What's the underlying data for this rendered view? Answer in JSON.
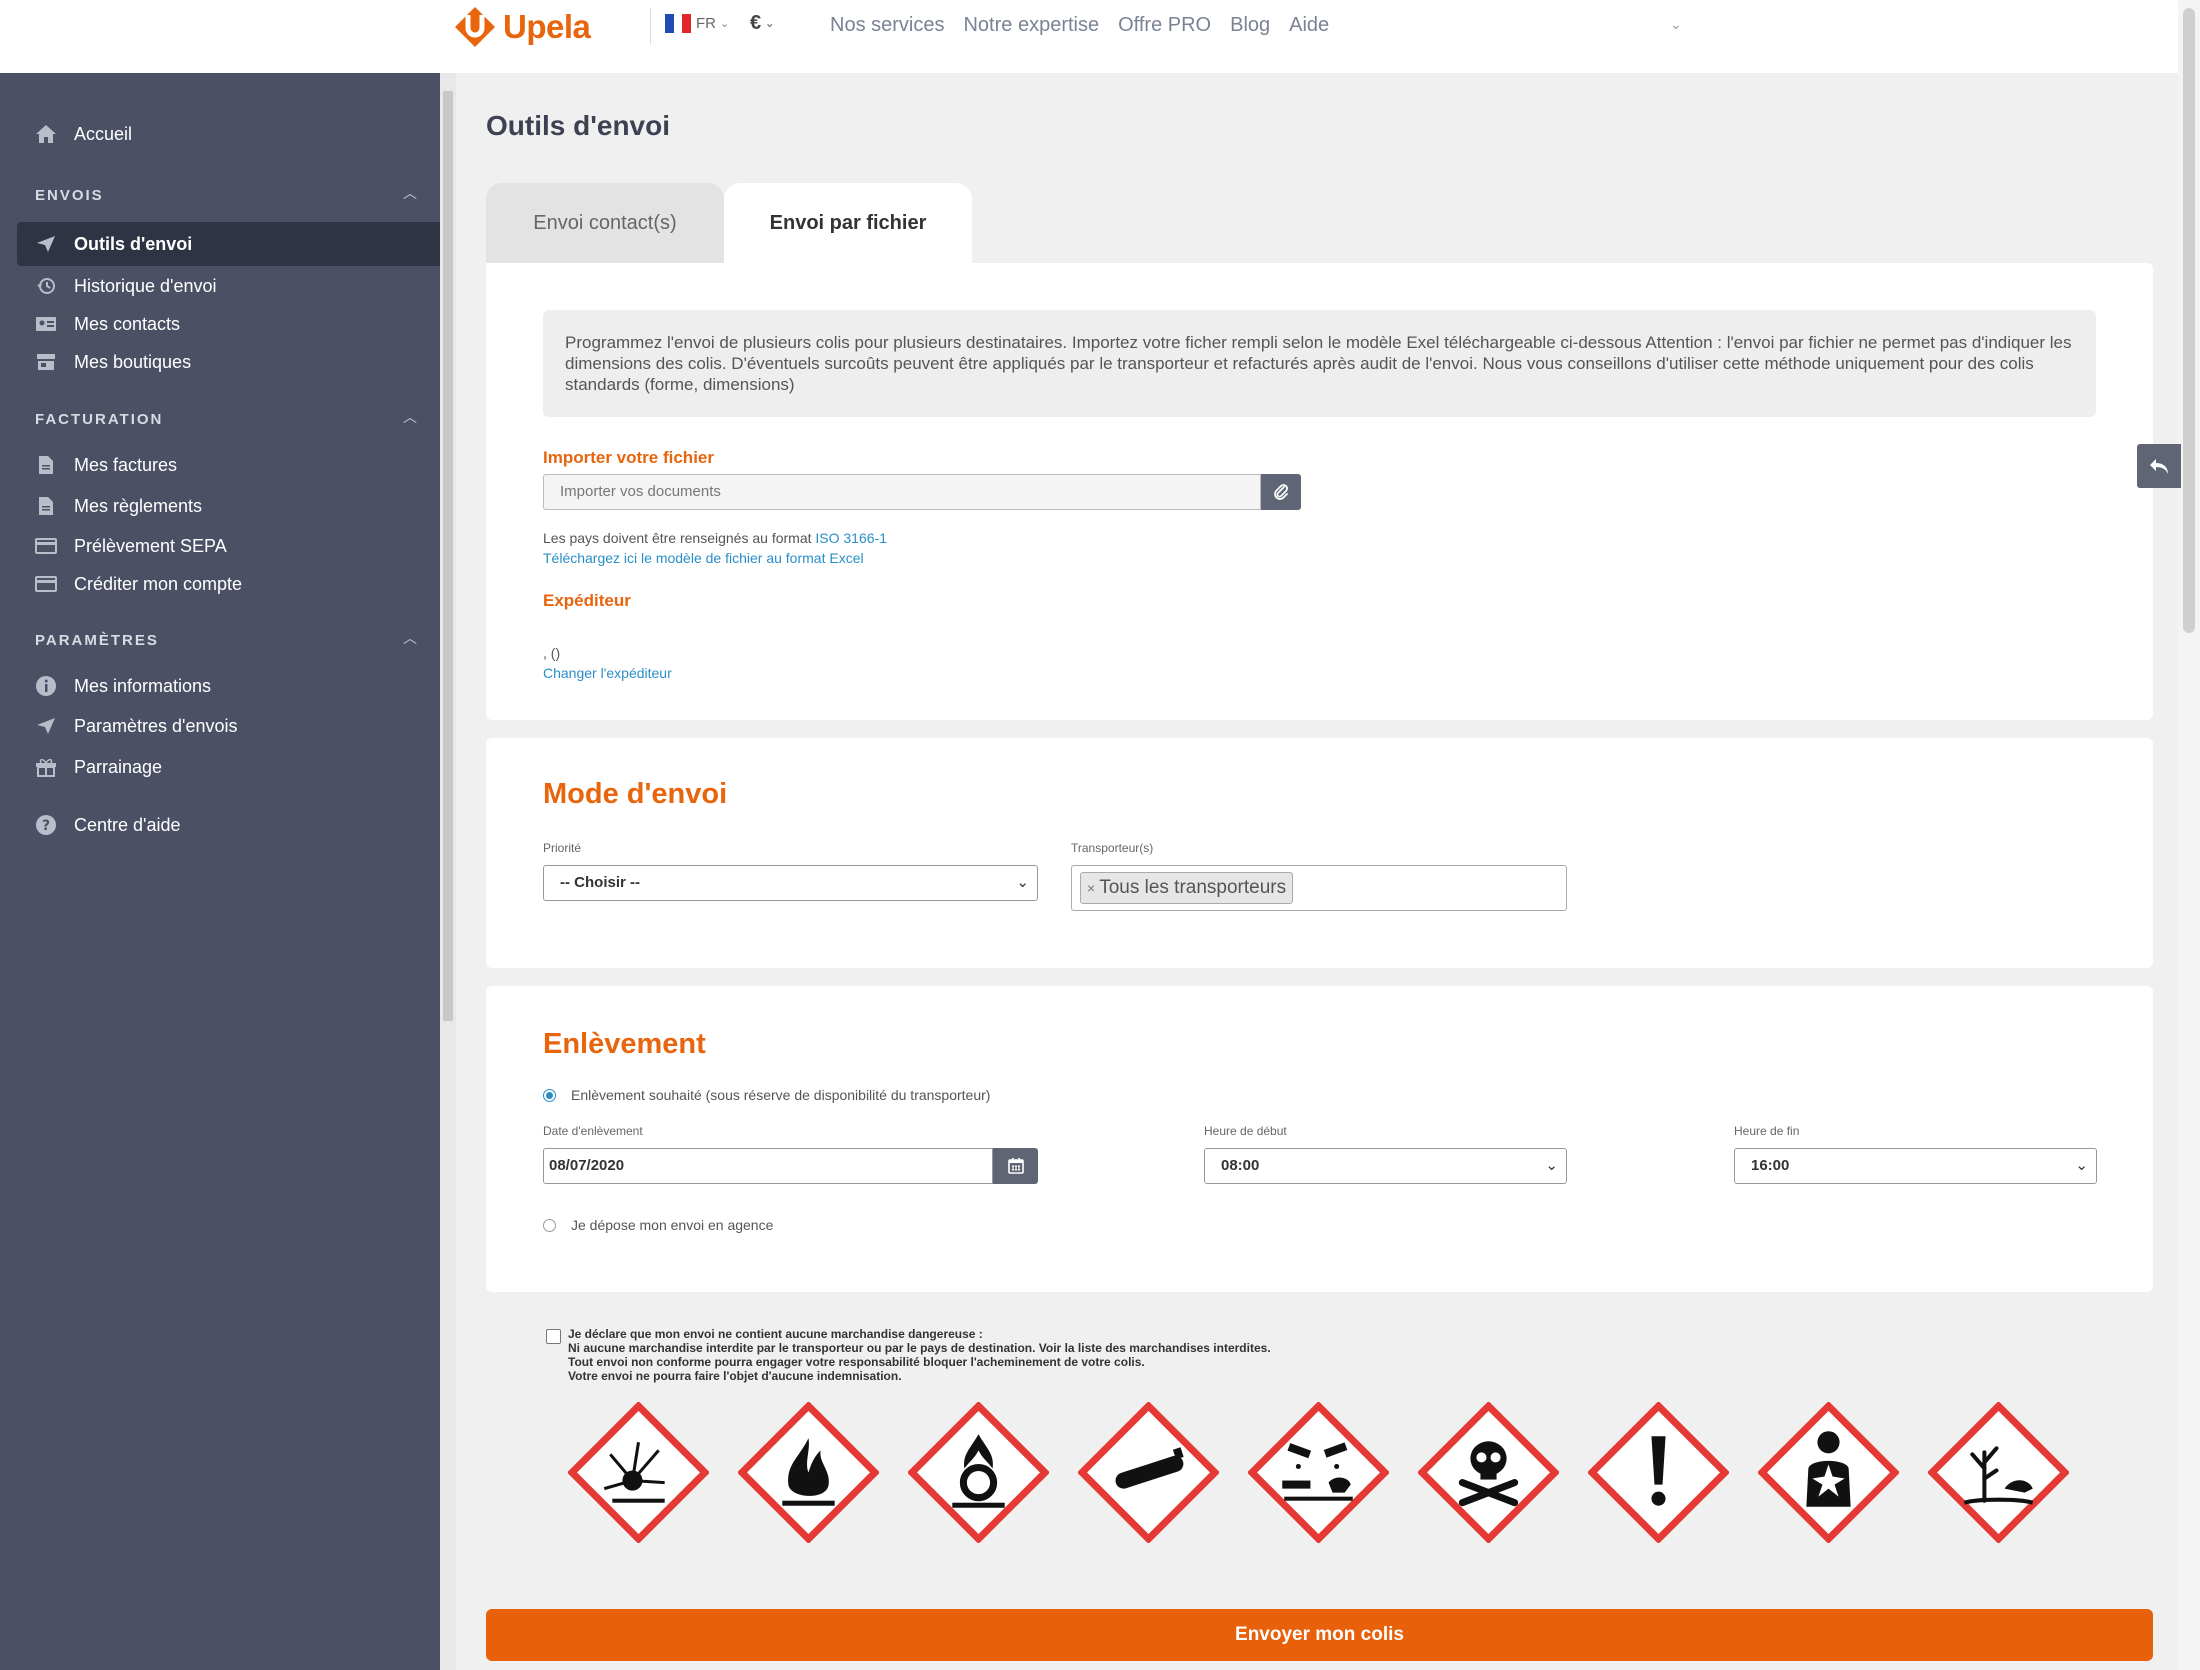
{
  "header": {
    "brand": "Upela",
    "lang": "FR",
    "currency": "€",
    "nav": [
      "Nos services",
      "Notre expertise",
      "Offre PRO",
      "Blog",
      "Aide"
    ]
  },
  "sidebar": {
    "home": "Accueil",
    "sections": [
      {
        "title": "ENVOIS",
        "items": [
          "Outils d'envoi",
          "Historique d'envoi",
          "Mes contacts",
          "Mes boutiques"
        ]
      },
      {
        "title": "FACTURATION",
        "items": [
          "Mes factures",
          "Mes règlements",
          "Prélèvement SEPA",
          "Créditer mon compte"
        ]
      },
      {
        "title": "PARAMÈTRES",
        "items": [
          "Mes informations",
          "Paramètres d'envois",
          "Parrainage"
        ]
      }
    ],
    "help": "Centre d'aide"
  },
  "main": {
    "title": "Outils d'envoi",
    "tabs": [
      "Envoi contact(s)",
      "Envoi par fichier"
    ],
    "info": "Programmez l'envoi de plusieurs colis pour plusieurs destinataires. Importez votre ficher rempli selon le modèle Exel téléchargeable ci-dessous Attention : l'envoi par fichier ne permet pas d'indiquer les dimensions des colis. D'éventuels surcoûts peuvent être appliqués par le transporteur et refacturés après audit de l'envoi. Nous vous conseillons d'utiliser cette méthode uniquement pour des colis standards (forme, dimensions)",
    "import_label": "Importer votre fichier",
    "import_placeholder": "Importer vos documents",
    "iso_text": "Les pays doivent être renseignés au format ",
    "iso_link": "ISO 3166-1",
    "excel_link": "Téléchargez ici le modèle de fichier au format Excel",
    "sender_label": "Expéditeur",
    "sender_value": ", ()",
    "change_sender": "Changer l'expéditeur"
  },
  "mode": {
    "title": "Mode d'envoi",
    "priority_label": "Priorité",
    "priority_value": "-- Choisir --",
    "carriers_label": "Transporteur(s)",
    "carrier_tag": "Tous les transporteurs"
  },
  "pickup": {
    "title": "Enlèvement",
    "option1": "Enlèvement souhaité (sous réserve de disponibilité du transporteur)",
    "date_label": "Date d'enlèvement",
    "date_value": "08/07/2020",
    "start_label": "Heure de début",
    "start_value": "08:00",
    "end_label": "Heure de fin",
    "end_value": "16:00",
    "option2": "Je dépose mon envoi en agence"
  },
  "declaration": {
    "line1": "Je déclare que mon envoi ne contient aucune marchandise dangereuse :",
    "line2": "Ni aucune marchandise interdite par le transporteur ou par le pays de destination. Voir la liste des marchandises interdites.",
    "line3": "Tout envoi non conforme pourra engager votre responsabilité bloquer l'acheminement de votre colis.",
    "line4": "Votre envoi ne pourra faire l'objet d'aucune indemnisation."
  },
  "hazard_icons": [
    "explosive-icon",
    "flammable-icon",
    "oxidizer-icon",
    "gas-cylinder-icon",
    "corrosive-icon",
    "toxic-icon",
    "exclamation-icon",
    "health-hazard-icon",
    "environment-icon"
  ],
  "submit_label": "Envoyer mon colis",
  "colors": {
    "accent": "#e8650e",
    "sidebar": "#4b5064",
    "link": "#2a8fc7",
    "hazard_red": "#e53935"
  }
}
